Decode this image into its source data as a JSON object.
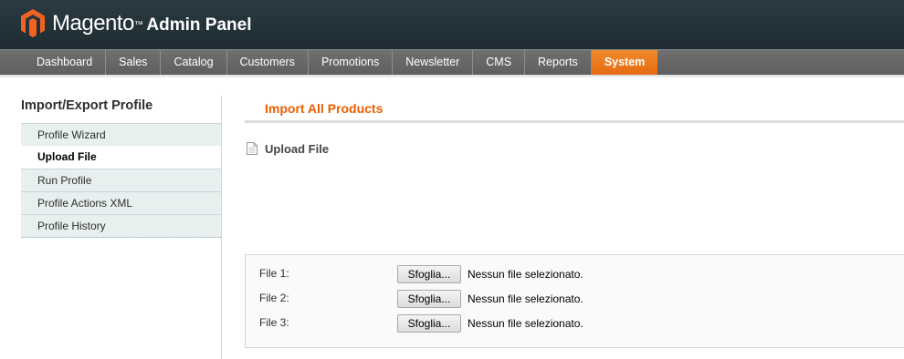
{
  "header": {
    "brand": "Magento",
    "trademark": "™",
    "subtitle": "Admin Panel",
    "logo_icon": "magento-logo-icon",
    "accent": "#eb5e00"
  },
  "nav": {
    "items": [
      "Dashboard",
      "Sales",
      "Catalog",
      "Customers",
      "Promotions",
      "Newsletter",
      "CMS",
      "Reports",
      "System"
    ],
    "active": "System"
  },
  "sidebar": {
    "title": "Import/Export Profile",
    "items": [
      "Profile Wizard",
      "Upload File",
      "Run Profile",
      "Profile Actions XML",
      "Profile History"
    ],
    "active": "Upload File"
  },
  "main": {
    "page_title": "Import All Products",
    "section_title": "Upload File",
    "section_icon": "document-icon",
    "files": [
      {
        "label": "File 1:",
        "button": "Sfoglia...",
        "status": "Nessun file selezionato."
      },
      {
        "label": "File 2:",
        "button": "Sfoglia...",
        "status": "Nessun file selezionato."
      },
      {
        "label": "File 3:",
        "button": "Sfoglia...",
        "status": "Nessun file selezionato."
      }
    ]
  }
}
